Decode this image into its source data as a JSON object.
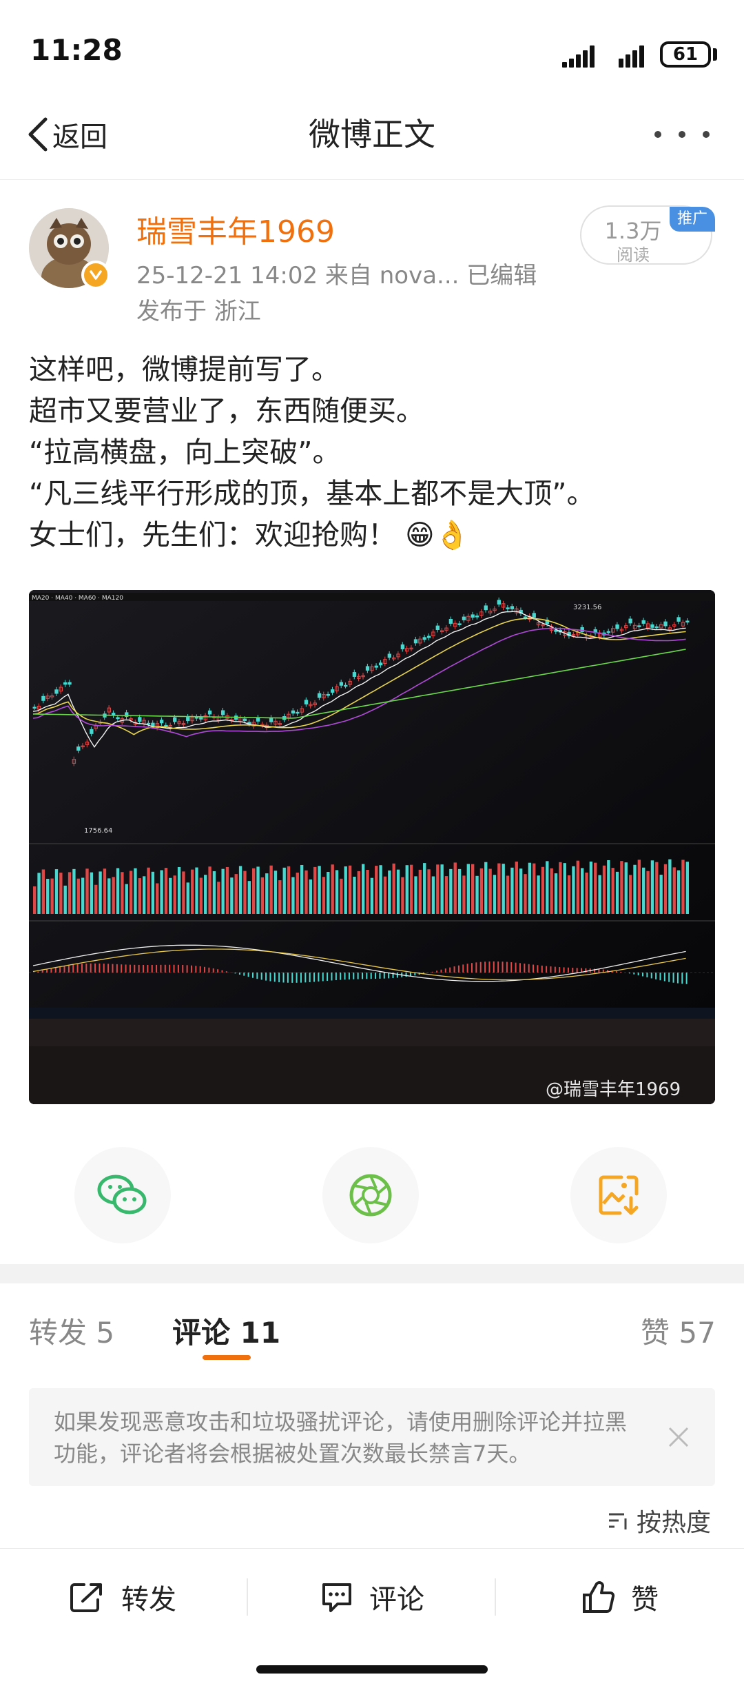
{
  "status_bar": {
    "time": "11:28",
    "battery": "61"
  },
  "nav": {
    "back_label": "返回",
    "title": "微博正文"
  },
  "post": {
    "author": "瑞雪丰年1969",
    "meta": "25-12-21 14:02  来自 nova...   已编辑",
    "location": "发布于 浙江",
    "reads_count": "1.3万",
    "reads_label": "阅读",
    "promo_tag": "推广",
    "body_lines": [
      "这样吧，微博提前写了。",
      "超市又要营业了，东西随便买。",
      "“拉高横盘，向上突破”。",
      "“凡三线平行形成的顶，基本上都不是大顶”。",
      "女士们，先生们：欢迎抢购！"
    ],
    "emoji": "😁👌",
    "image_watermark": "@瑞雪丰年1969",
    "chart_low_label": "1756.64",
    "chart_high_label": "3231.56"
  },
  "tabs": {
    "reposts": "转发 5",
    "comments": "评论 11",
    "likes": "赞 57"
  },
  "notice": "如果发现恶意攻击和垃圾骚扰评论，请使用删除评论并拉黑功能，评论者将会根据被处置次数最长禁言7天。",
  "sort_label": "按热度",
  "bottom_bar": {
    "repost": "转发",
    "comment": "评论",
    "like": "赞"
  },
  "colors": {
    "accent": "#f0700e",
    "wechat": "#38b86c",
    "moments": "#6cc04a",
    "save": "#f5a623"
  },
  "icons": [
    "signal-icon",
    "battery-icon",
    "back-chevron-icon",
    "more-icon",
    "verified-icon",
    "wechat-icon",
    "moments-icon",
    "save-image-icon",
    "close-icon",
    "sort-icon",
    "repost-icon",
    "comment-icon",
    "like-icon"
  ]
}
